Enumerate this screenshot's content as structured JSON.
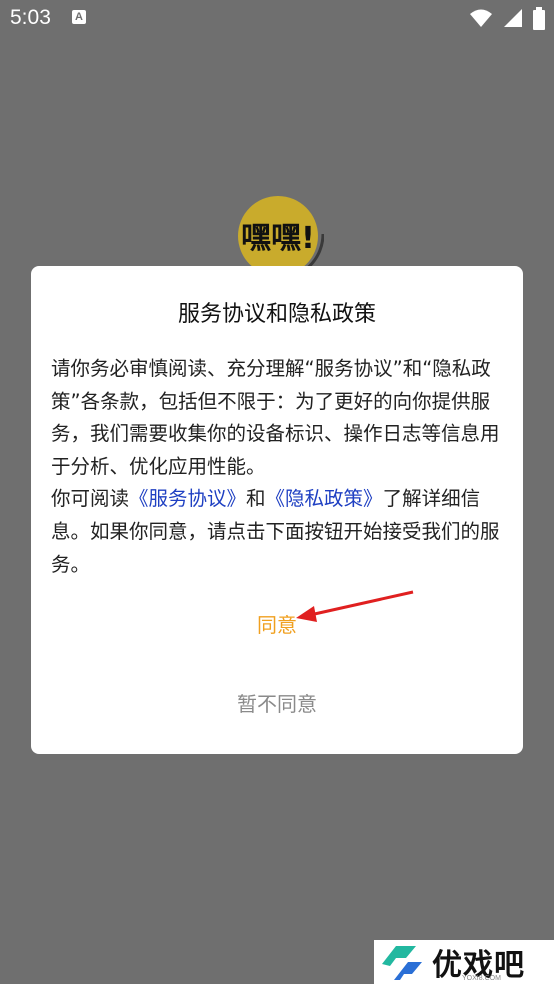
{
  "status_bar": {
    "time": "5:03",
    "notification_icon": "a-letter-icon",
    "icons": [
      "wifi-icon",
      "signal-icon",
      "battery-icon"
    ]
  },
  "logo": {
    "text": "嘿嘿!",
    "background_color": "#e6c233"
  },
  "dialog": {
    "title": "服务协议和隐私政策",
    "body_part1": "请你务必审慎阅读、充分理解“服务协议”和“隐私政策”各条款，包括但不限于：为了更好的向你提供服务，我们需要收集你的设备标识、操作日志等信息用于分析、优化应用性能。",
    "body_part2_prefix": "你可阅读",
    "service_agreement_link": "《服务协议》",
    "conjunction": "和",
    "privacy_policy_link": "《隐私政策》",
    "body_part2_suffix": "了解详细信息。如果你同意，请点击下面按钮开始接受我们的服务。",
    "agree_label": "同意",
    "decline_label": "暂不同意"
  },
  "colors": {
    "overlay": "#6f6f6f",
    "link": "#1e3fc2",
    "agree": "#f0a020",
    "decline": "#8a8a8a",
    "arrow": "#e02020"
  },
  "watermark": {
    "text": "优戏吧",
    "url": "YOXI8.COM"
  }
}
